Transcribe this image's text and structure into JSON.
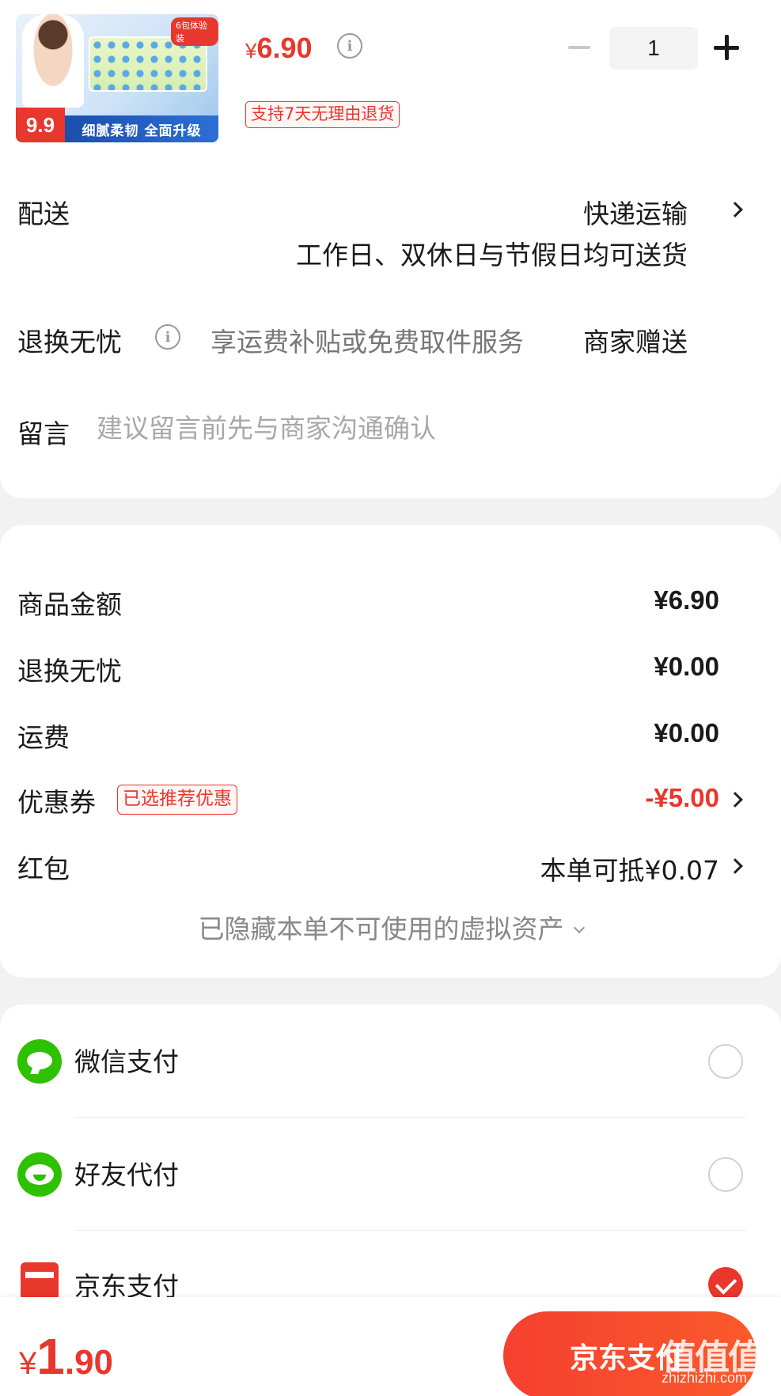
{
  "product": {
    "thumbnail": {
      "tag": "6包体验装",
      "badge_price": "9.9",
      "banner": "细腻柔韧 全面升级"
    },
    "price_currency": "¥",
    "price_value": "6.90",
    "return_badge": "支持7天无理由退货",
    "quantity": "1"
  },
  "delivery": {
    "label": "配送",
    "method": "快递运输",
    "note": "工作日、双休日与节假日均可送货"
  },
  "return_service": {
    "label": "退换无忧",
    "description": "享运费补贴或免费取件服务",
    "value": "商家赠送"
  },
  "message": {
    "label": "留言",
    "placeholder": "建议留言前先与商家沟通确认"
  },
  "summary": {
    "goods_label": "商品金额",
    "goods_value": "¥6.90",
    "return_label": "退换无忧",
    "return_value": "¥0.00",
    "shipping_label": "运费",
    "shipping_value": "¥0.00",
    "coupon_label": "优惠券",
    "coupon_tag": "已选推荐优惠",
    "coupon_value": "-¥5.00",
    "redpacket_label": "红包",
    "redpacket_value": "本单可抵¥0.07",
    "hidden_assets": "已隐藏本单不可使用的虚拟资产"
  },
  "payment": {
    "options": [
      {
        "label": "微信支付",
        "icon": "wechat-pay-icon",
        "selected": false
      },
      {
        "label": "好友代付",
        "icon": "friend-pay-icon",
        "selected": false
      },
      {
        "label": "京东支付",
        "icon": "jd-pay-icon",
        "selected": true
      }
    ]
  },
  "bottom": {
    "total_currency": "¥",
    "total_int": "1",
    "total_dec": ".90",
    "pay_button": "京东支付"
  },
  "watermark": {
    "text": "值值值",
    "url": "zhizhizhi.com"
  },
  "colors": {
    "accent": "#e8372c",
    "wechat_green": "#2dc100",
    "background": "#f2f2f2"
  }
}
